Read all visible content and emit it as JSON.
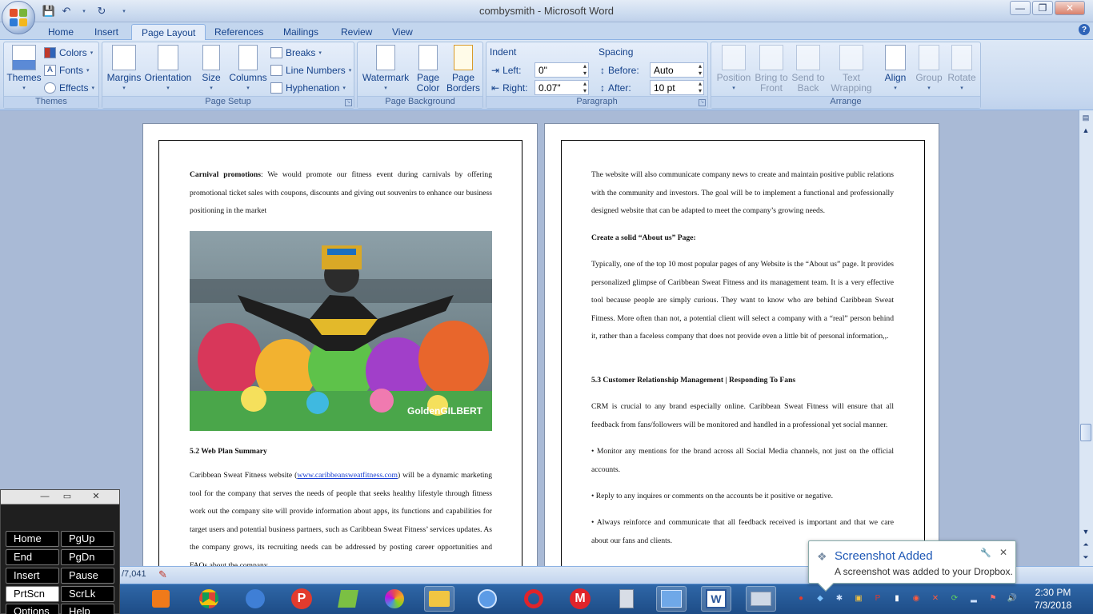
{
  "window": {
    "title": "combysmith - Microsoft Word",
    "controls": {
      "minimize": "—",
      "maximize": "❐",
      "close": "✕"
    }
  },
  "tabs": [
    {
      "label": "Home"
    },
    {
      "label": "Insert"
    },
    {
      "label": "Page Layout",
      "active": true
    },
    {
      "label": "References"
    },
    {
      "label": "Mailings"
    },
    {
      "label": "Review"
    },
    {
      "label": "View"
    }
  ],
  "ribbon": {
    "themes": {
      "label": "Themes",
      "themes": "Themes",
      "colors": "Colors",
      "fonts": "Fonts",
      "effects": "Effects"
    },
    "page_setup": {
      "label": "Page Setup",
      "margins": "Margins",
      "orientation": "Orientation",
      "size": "Size",
      "columns": "Columns",
      "breaks": "Breaks",
      "line_numbers": "Line Numbers",
      "hyphenation": "Hyphenation"
    },
    "page_background": {
      "label": "Page Background",
      "watermark": "Watermark",
      "page_color_1": "Page",
      "page_color_2": "Color",
      "page_borders_1": "Page",
      "page_borders_2": "Borders"
    },
    "paragraph": {
      "label": "Paragraph",
      "indent": "Indent",
      "left_label": "Left:",
      "left_value": "0\"",
      "right_label": "Right:",
      "right_value": "0.07\"",
      "spacing": "Spacing",
      "before_label": "Before:",
      "before_value": "Auto",
      "after_label": "After:",
      "after_value": "10 pt"
    },
    "arrange": {
      "label": "Arrange",
      "position": "Position",
      "bring_front_1": "Bring to",
      "bring_front_2": "Front",
      "send_back_1": "Send to",
      "send_back_2": "Back",
      "text_wrap_1": "Text",
      "text_wrap_2": "Wrapping",
      "align": "Align",
      "group": "Group",
      "rotate": "Rotate"
    }
  },
  "document": {
    "left_page": {
      "carnival_heading": "Carnival promotions",
      "carnival_text": ": We would promote our fitness event during carnivals by offering promotional ticket sales with coupons, discounts and giving out souvenirs to enhance our business positioning in the market",
      "photo_watermark": "GoldenGILBERT",
      "section_heading": "5.2 Web Plan Summary",
      "web_text_1": "Caribbean Sweat Fitness website (",
      "web_link": "www.caribbeansweatfitness.com",
      "web_text_2": ") will be a dynamic marketing tool for the company that serves the needs of people that seeks healthy lifestyle through fitness work out the company site will provide information about apps, its functions and capabilities for target users and potential business partners, such as Caribbean Sweat Fitness’ services updates. As the company grows, its recruiting needs can be addressed by posting career opportunities and FAQs about the company."
    },
    "right_page": {
      "para_1": "The website will also communicate company news to create and maintain positive public relations with the community and investors. The goal will be to implement a functional and professionally designed website that can be adapted to meet the company’s growing needs.",
      "heading_about": "Create a solid “About us” Page:",
      "para_about": "Typically, one of the top 10 most popular pages of any Website is the “About us” page. It provides personalized glimpse of Caribbean Sweat Fitness and its management team. It is a very effective tool because people are simply curious. They want to know who are behind Caribbean Sweat Fitness. More often than not, a potential client will select a company with a “real” person behind it, rather than a faceless company that does not provide even a little bit of personal information,,.",
      "heading_crm": "5.3 Customer Relationship Management | Responding To Fans",
      "para_crm": "CRM is crucial to any brand especially online. Caribbean Sweat Fitness will ensure that all feedback from fans/followers will be monitored and handled in a professional yet social manner.",
      "bullet_1": "• Monitor any mentions for the brand across all Social Media channels, not just on the official accounts.",
      "bullet_2": "• Reply to any inquires or comments on the accounts be it positive or negative.",
      "bullet_3": "• Always reinforce and communicate that all feedback received is important and that we care about our fans and clients."
    }
  },
  "statusbar": {
    "word_count": "/7,041"
  },
  "osk": {
    "keys": [
      {
        "label": "Home"
      },
      {
        "label": "PgUp"
      },
      {
        "label": "End"
      },
      {
        "label": "PgDn"
      },
      {
        "label": "Insert"
      },
      {
        "label": "Pause"
      },
      {
        "label": "PrtScn",
        "highlighted": true
      },
      {
        "label": "ScrLk"
      },
      {
        "label": "Options"
      },
      {
        "label": "Help"
      }
    ]
  },
  "toast": {
    "title": "Screenshot Added",
    "body": "A screenshot was added to your Dropbox."
  },
  "taskbar": {
    "clock_time": "2:30 PM",
    "clock_date": "7/3/2018"
  },
  "colors": {
    "accent": "#15428b",
    "ribbon": "#c8d9f0",
    "taskbar": "#1d4c86",
    "link": "#1a3fd1"
  }
}
